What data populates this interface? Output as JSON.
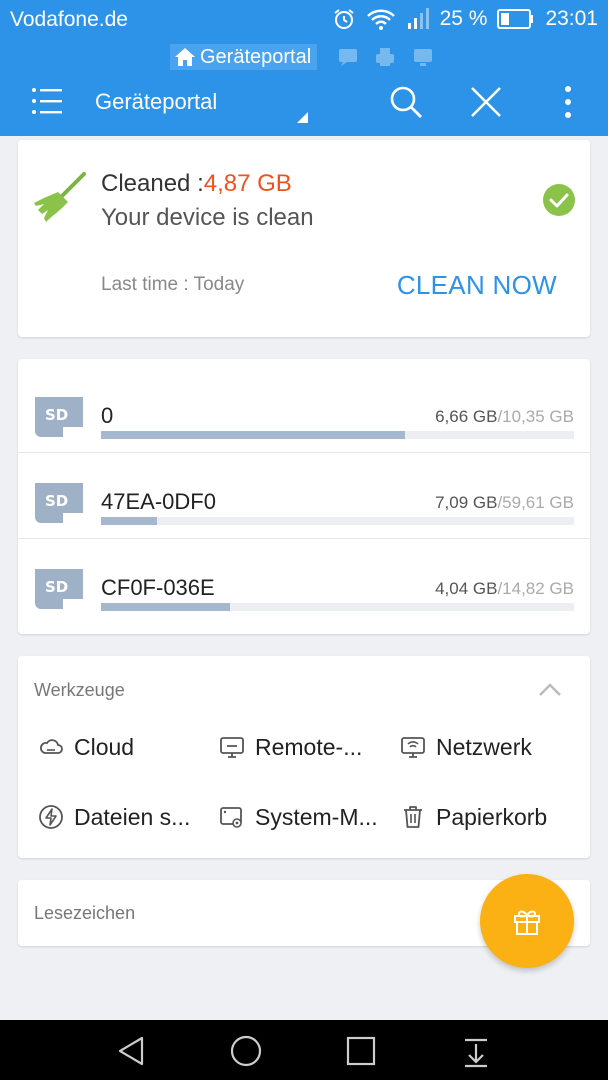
{
  "status_bar": {
    "carrier": "Vodafone.de",
    "battery": "25 %",
    "time": "23:01"
  },
  "app_bar": {
    "tab_label": "Geräteportal",
    "title": "Geräteportal"
  },
  "cleaner": {
    "cleaned_label": "Cleaned :",
    "cleaned_value": "4,87 GB",
    "status": "Your device is clean",
    "last_time": "Last time : Today",
    "action": "CLEAN NOW"
  },
  "storage": [
    {
      "name": "0",
      "used": "6,66 GB",
      "total": "/10,35 GB",
      "fraction": 0.643
    },
    {
      "name": "47EA-0DF0",
      "used": "7,09 GB",
      "total": "/59,61 GB",
      "fraction": 0.119
    },
    {
      "name": "CF0F-036E",
      "used": "4,04 GB",
      "total": "/14,82 GB",
      "fraction": 0.273
    }
  ],
  "tools": {
    "header": "Werkzeuge",
    "items": [
      {
        "label": "Cloud",
        "icon": "cloud-icon"
      },
      {
        "label": "Remote-...",
        "icon": "remote-icon"
      },
      {
        "label": "Netzwerk",
        "icon": "network-icon"
      },
      {
        "label": "Dateien s...",
        "icon": "transfer-icon"
      },
      {
        "label": "System-M...",
        "icon": "system-manager-icon"
      },
      {
        "label": "Papierkorb",
        "icon": "trash-icon"
      }
    ]
  },
  "bookmarks": {
    "header": "Lesezeichen"
  },
  "colors": {
    "primary": "#2c93e8",
    "accent_orange": "#f0521f",
    "success_green": "#8bc34a",
    "fab": "#fbb114"
  }
}
